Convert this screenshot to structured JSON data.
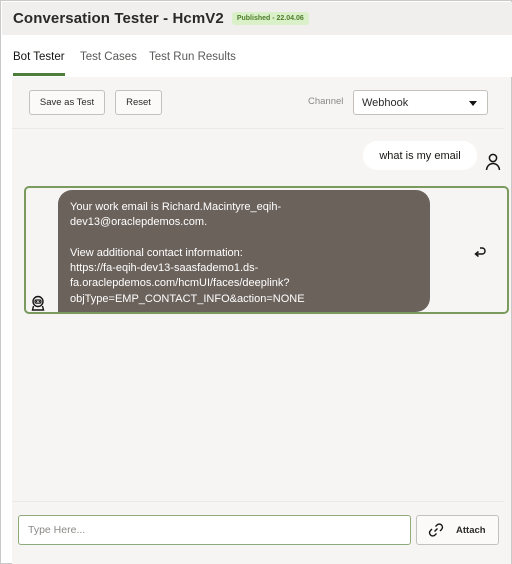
{
  "header": {
    "title": "Conversation Tester - HcmV2",
    "badge": "Published - 22.04.06",
    "badge_color": "#d9f0c9"
  },
  "tabs": [
    {
      "label": "Bot Tester",
      "active": true
    },
    {
      "label": "Test Cases",
      "active": false
    },
    {
      "label": "Test Run Results",
      "active": false
    }
  ],
  "toolbar": {
    "save_label": "Save as Test",
    "reset_label": "Reset",
    "channel_label": "Channel",
    "channel_value": "Webhook"
  },
  "conversation": {
    "user_message": "what is my email",
    "bot_message": {
      "line1": "Your work email is Richard.Macintyre_eqih-",
      "line2": "dev13@oraclepdemos.com.",
      "line3": "View additional contact information:",
      "line4": "https://fa-eqih-dev13-saasfademo1.ds-",
      "line5": "fa.oraclepdemos.com/hcmUI/faces/deeplink?",
      "line6": "objType=EMP_CONTACT_INFO&action=NONE"
    },
    "icons": {
      "user": "user-icon",
      "bot": "bot-icon",
      "reply": "reply-icon"
    }
  },
  "composer": {
    "placeholder": "Type Here...",
    "value": "",
    "attach_label": "Attach",
    "attach_icon": "link-icon"
  },
  "colors": {
    "accent": "#4f7d3a",
    "bot_bubble": "#6b625c",
    "selected_border": "#7a9a5e"
  }
}
